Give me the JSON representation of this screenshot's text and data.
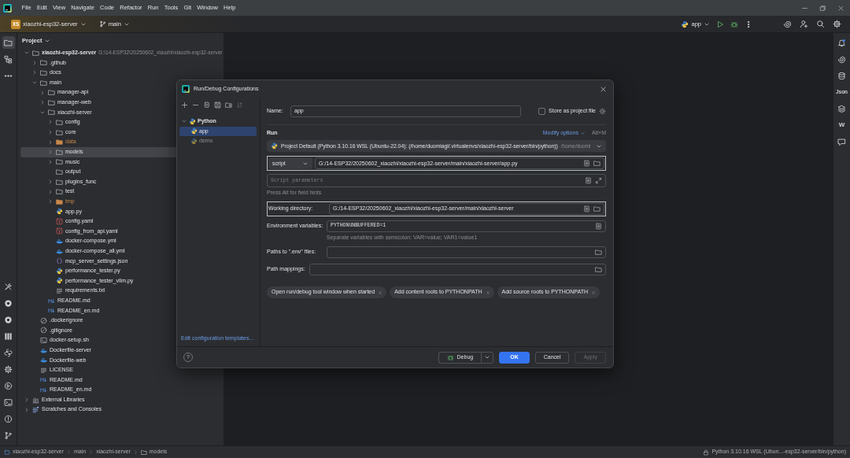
{
  "menu": [
    "File",
    "Edit",
    "View",
    "Navigate",
    "Code",
    "Refactor",
    "Run",
    "Tools",
    "Git",
    "Window",
    "Help"
  ],
  "toolbar": {
    "project_badge": "XS",
    "project": "xiaozhi-esp32-server",
    "branch": "main",
    "run_config": "app"
  },
  "left_tools": [
    {
      "kind": "folder",
      "selected": true
    },
    {
      "kind": "structure",
      "selected": false
    },
    {
      "kind": "more",
      "selected": false
    }
  ],
  "left_tools_bottom": [
    {
      "kind": "wrench"
    },
    {
      "kind": "ring"
    },
    {
      "kind": "ring"
    },
    {
      "kind": "columns"
    },
    {
      "kind": "python"
    },
    {
      "kind": "gear"
    },
    {
      "kind": "run"
    },
    {
      "kind": "terminal"
    },
    {
      "kind": "alert"
    },
    {
      "kind": "branch"
    }
  ],
  "right_tools": [
    {
      "kind": "bell"
    },
    {
      "kind": "spiral"
    },
    {
      "kind": "database"
    },
    {
      "kind": "label",
      "text": "Json"
    },
    {
      "kind": "layers"
    },
    {
      "kind": "label",
      "text": "W"
    },
    {
      "kind": "chat"
    }
  ],
  "project_panel": {
    "title": "Project",
    "tree": [
      {
        "name": "xiaozhi-esp32-server",
        "path": "G:\\14-ESP32\\20250602_xiaozhi\\xiaozhi-esp32-server",
        "kind": "folder",
        "expanded": true,
        "selected": false,
        "children": [
          {
            "name": ".github",
            "kind": "folder",
            "expanded": false,
            "selected": false
          },
          {
            "name": "docs",
            "kind": "folder",
            "expanded": false,
            "selected": false
          },
          {
            "name": "main",
            "kind": "folder",
            "expanded": true,
            "selected": false,
            "children": [
              {
                "name": "manager-api",
                "kind": "folder",
                "expanded": false,
                "selected": false
              },
              {
                "name": "manager-web",
                "kind": "folder",
                "expanded": false,
                "selected": false
              },
              {
                "name": "xiaozhi-server",
                "kind": "folder",
                "expanded": true,
                "selected": false,
                "children": [
                  {
                    "name": "config",
                    "kind": "folder",
                    "expanded": false,
                    "selected": false
                  },
                  {
                    "name": "core",
                    "kind": "folder",
                    "expanded": false,
                    "selected": false
                  },
                  {
                    "name": "data",
                    "kind": "folder",
                    "expanded": false,
                    "selected": false,
                    "color": "#c8874a"
                  },
                  {
                    "name": "models",
                    "kind": "folder",
                    "expanded": false,
                    "selected": true
                  },
                  {
                    "name": "music",
                    "kind": "folder",
                    "expanded": false,
                    "selected": false
                  },
                  {
                    "name": "output",
                    "kind": "folder",
                    "selected": false
                  },
                  {
                    "name": "plugins_func",
                    "kind": "folder",
                    "expanded": false,
                    "selected": false
                  },
                  {
                    "name": "test",
                    "kind": "folder",
                    "expanded": false,
                    "selected": false
                  },
                  {
                    "name": "tmp",
                    "kind": "folder",
                    "expanded": false,
                    "selected": false,
                    "color": "#c8874a"
                  },
                  {
                    "name": "app.py",
                    "kind": "python",
                    "selected": false
                  },
                  {
                    "name": "config.yaml",
                    "kind": "yaml",
                    "selected": false
                  },
                  {
                    "name": "config_from_api.yaml",
                    "kind": "yaml",
                    "selected": false
                  },
                  {
                    "name": "docker-compose.yml",
                    "kind": "docker",
                    "selected": false
                  },
                  {
                    "name": "docker-compose_all.yml",
                    "kind": "docker",
                    "selected": false
                  },
                  {
                    "name": "mcp_server_settings.json",
                    "kind": "json",
                    "selected": false
                  },
                  {
                    "name": "performance_tester.py",
                    "kind": "python",
                    "selected": false
                  },
                  {
                    "name": "performance_tester_vllm.py",
                    "kind": "python",
                    "selected": false
                  },
                  {
                    "name": "requirements.txt",
                    "kind": "text",
                    "selected": false
                  }
                ]
              },
              {
                "name": "README.md",
                "kind": "markdown",
                "selected": false
              },
              {
                "name": "README_en.md",
                "kind": "markdown",
                "selected": false
              }
            ]
          },
          {
            "name": ".dockerignore",
            "kind": "ignore",
            "selected": false
          },
          {
            "name": ".gitignore",
            "kind": "ignore",
            "selected": false
          },
          {
            "name": "docker-setup.sh",
            "kind": "shell",
            "selected": false
          },
          {
            "name": "Dockerfile-server",
            "kind": "docker",
            "selected": false
          },
          {
            "name": "Dockerfile-web",
            "kind": "docker",
            "selected": false
          },
          {
            "name": "LICENSE",
            "kind": "text",
            "selected": false
          },
          {
            "name": "README.md",
            "kind": "markdown",
            "selected": false
          },
          {
            "name": "README_en.md",
            "kind": "markdown",
            "selected": false
          }
        ]
      },
      {
        "name": "External Libraries",
        "kind": "library",
        "expanded": false,
        "selected": false
      },
      {
        "name": "Scratches and Consoles",
        "kind": "scratch",
        "expanded": false,
        "selected": false
      }
    ]
  },
  "dialog": {
    "title": "Run/Debug Configurations",
    "config_tree": [
      {
        "label": "Python",
        "expanded": true,
        "children": [
          {
            "label": "app",
            "selected": true,
            "temporary": false
          },
          {
            "label": "demo",
            "selected": false,
            "temporary": true
          }
        ]
      }
    ],
    "templates_link": "Edit configuration templates...",
    "name_label": "Name:",
    "name_value": "app",
    "store_checkbox": {
      "label": "Store as project file",
      "checked": false
    },
    "section": "Run",
    "modify_options": "Modify options",
    "modify_shortcut": "Alt+M",
    "interpreter": "Project Default (Python 3.10.16 WSL (Ubuntu-22.04): (/home/duomiagi/.virtualenvs/xiaozhi-esp32-server/bin/python))",
    "interpreter_hint": "/home/duomi",
    "script_type": "script",
    "script_path": "G:/14-ESP32/20250602_xiaozhi/xiaozhi-esp32-server/main/xiaozhi-server/app.py",
    "params_placeholder": "Script parameters",
    "field_hint": "Press Alt for field hints",
    "workdir_label": "Working directory:",
    "workdir_value": "G:/14-ESP32/20250602_xiaozhi/xiaozhi-esp32-server/main/xiaozhi-server",
    "env_label": "Environment variables:",
    "env_value": "PYTHONUNBUFFERED=1",
    "env_hint": "Separate variables with semicolon: VAR=value; VAR1=value1",
    "envfiles_label": "Paths to \".env\" files:",
    "mappings_label": "Path mappings:",
    "chips": [
      "Open run/debug tool window when started",
      "Add content roots to PYTHONPATH",
      "Add source roots to PYTHONPATH"
    ],
    "help": "?",
    "buttons": [
      {
        "kind": "split",
        "label": "Debug",
        "disabled": false
      },
      {
        "kind": "primary",
        "label": "OK",
        "disabled": false
      },
      {
        "kind": "normal",
        "label": "Cancel",
        "disabled": false
      },
      {
        "kind": "normal",
        "label": "Apply",
        "disabled": true
      }
    ]
  },
  "status_bar": {
    "breadcrumbs": [
      {
        "kind": "module",
        "text": "xiaozhi-esp32-server"
      },
      {
        "text": "main"
      },
      {
        "text": "xiaozhi-server"
      },
      {
        "kind": "folder",
        "text": "models"
      }
    ],
    "interpreter": "Python 3.10.16 WSL (Ubun...-esp32-server/bin/python)"
  }
}
